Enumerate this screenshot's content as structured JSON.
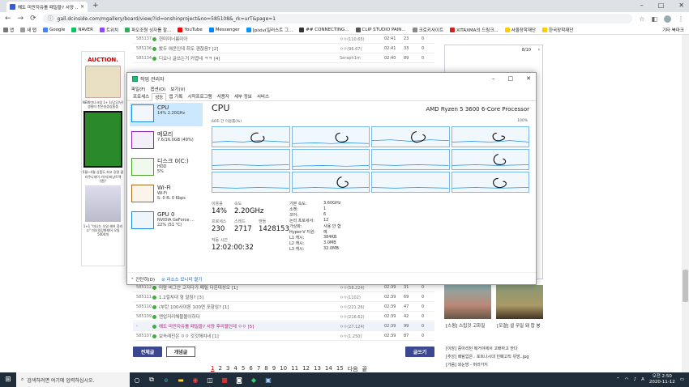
{
  "browser": {
    "tab_title": "해도 미만자유를 패밀을? 서양 ...",
    "url": "gall.dcinside.com/mgallery/board/view/?id=onshinproject&no=585108&_rk=urT&page=1",
    "bookmarks": [
      "앱",
      "새 탭",
      "Google",
      "NAVER",
      "트위치",
      "파오조원 싱자를 할...",
      "YouTube",
      "Messenger",
      "[pixiv(일러스트 그...",
      "## CONNECTING...",
      "CLIP STUDIO PAIN...",
      "크로키사이트",
      "XITAXMA의 드링크...",
      "서울장학재단",
      "한국장학재단"
    ],
    "bookmarks_right": "기타 북마크"
  },
  "board_top": [
    {
      "no": "585137",
      "subject": "현미미너름미아",
      "writer": "ㅇㅇ(110.65)",
      "date": "02:41",
      "views": "23",
      "rec": "0"
    },
    {
      "no": "585136",
      "subject": "봤두 애쿤인데 최도 괜찮음? [2]",
      "writer": "ㅇㅇ(96.67)",
      "date": "02:41",
      "views": "33",
      "rec": "0"
    },
    {
      "no": "585134",
      "subject": "디오나 글쓰는거 커엽네 ㅋㅋ [4]",
      "writer": "Seraph1m",
      "date": "02:40",
      "views": "89",
      "rec": "0"
    }
  ],
  "board_bottom": [
    {
      "no": "585112",
      "subject": "미맘 버그안 고저다가 폐릴 다운대성오 [1]",
      "writer": "ㅇㅇ(58.224)",
      "date": "02:39",
      "views": "31",
      "rec": "0",
      "hl": false
    },
    {
      "no": "585111",
      "subject": "1.2컬치대 형 말짐? [3]",
      "writer": "ㅇㅇ(1102)",
      "date": "02:39",
      "views": "69",
      "rec": "0",
      "hl": false
    },
    {
      "no": "585110",
      "subject": "(부탄 100사이론 100연 포함임? [1]",
      "writer": "ㅇㅇ(221.26)",
      "date": "02:39",
      "views": "47",
      "rec": "0",
      "hl": false
    },
    {
      "no": "585109",
      "subject": "엔업저리해물몰아하다",
      "writer": "ㅇㅇ(216.62)",
      "date": "02:39",
      "views": "42",
      "rec": "0",
      "hl": false
    },
    {
      "no": "›",
      "subject": "해도 미만자유를 패밀을? 서양 후리웹인데 ㅇㅇ [5]",
      "writer": "ㅇㅇ(27.124)",
      "date": "02:39",
      "views": "99",
      "rec": "0",
      "hl": true
    },
    {
      "no": "585107",
      "subject": "보속래진은 ㅇㅇ 갓갓해치네 [1]",
      "writer": "ㅇㅇ(1.250)",
      "date": "02:39",
      "views": "87",
      "rec": "0",
      "hl": false
    }
  ],
  "board_buttons": {
    "all": "전체글",
    "featured": "개념글",
    "write": "글쓰기"
  },
  "pager": [
    "1",
    "2",
    "3",
    "4",
    "5",
    "6",
    "7",
    "8",
    "9",
    "10",
    "11",
    "12",
    "13",
    "14",
    "15",
    "다음",
    "끝"
  ],
  "ad": {
    "brand": "AUCTION.",
    "t1": "NEW미나크림 1+ 1/당무/난/생필터 찬은실생상흡품",
    "t2": "5월~4월 싱품도 최고 강령 괄리쿠니데이 가(지)비냥트렉(엔)!",
    "t3": "1+1 \"미나는 오일 헤어 정리소\" 미오일강화테어 오일 5400개"
  },
  "right": {
    "counter": "8/10",
    "cap1": "[스윔] 스팁것 고화질",
    "cap2": "[모결] 셜 무밀 돼 합 봉",
    "news1": "[이장] 중아리턴 메거야에서 고배하고 한다",
    "news2": "[추앙] 배탐업은.. 포트나시대 민폐고직 유방..jpg",
    "news3": "[가음] 외눈방 - 머러가지"
  },
  "tm": {
    "title": "작업 관리자",
    "menu": [
      "파일(F)",
      "옵션(O)",
      "보기(V)"
    ],
    "tabs": [
      "프로세스",
      "성능",
      "앱 기록",
      "시작프로그램",
      "사용자",
      "세부 정보",
      "서비스"
    ],
    "side": [
      {
        "name": "CPU",
        "sub1": "14%  2.20GHz",
        "sub2": "",
        "cls": ""
      },
      {
        "name": "메모리",
        "sub1": "7.6/16.0GB (49%)",
        "sub2": "",
        "cls": "mem"
      },
      {
        "name": "디스크 0(C:)",
        "sub1": "HDD",
        "sub2": "5%",
        "cls": "disk"
      },
      {
        "name": "Wi-Fi",
        "sub1": "Wi-Fi",
        "sub2": "S: 0  R: 0 Kbps",
        "cls": "wifi"
      },
      {
        "name": "GPU 0",
        "sub1": "NVIDIA GeForce ...",
        "sub2": "22% (51 °C)",
        "cls": "gpu"
      }
    ],
    "cpu_title": "CPU",
    "model": "AMD Ryzen 5 3600 6-Core Processor",
    "graph_label": "60초 간 이용률(%)",
    "graph_max": "100%",
    "util_label": "이용률",
    "util": "14%",
    "speed_label": "속도",
    "speed": "2.20GHz",
    "proc_label": "프로세스",
    "proc": "230",
    "thread_label": "스레드",
    "thread": "2717",
    "handle_label": "핸들",
    "handle": "1428153",
    "uptime_label": "작동 시간",
    "uptime": "12:02:00:32",
    "specs": [
      [
        "기본 속도:",
        "3.60GHz"
      ],
      [
        "소켓:",
        "1"
      ],
      [
        "코어:",
        "6"
      ],
      [
        "논리 프로세서:",
        "12"
      ],
      [
        "가상화:",
        "사용 안 함"
      ],
      [
        "Hyper-V 지원:",
        "예"
      ],
      [
        "L1 캐시:",
        "384KB"
      ],
      [
        "L2 캐시:",
        "3.0MB"
      ],
      [
        "L3 캐시:",
        "32.0MB"
      ]
    ],
    "fewer": "간단히(D)",
    "monitor": "리소스 모니터 열기"
  },
  "taskbar": {
    "search": "검색하려면 여기에 입력하십시오.",
    "time": "오전 2:50",
    "date": "2020-11-12"
  },
  "colors": {
    "cpu_blue": "#1c8de0",
    "board_blue": "#3b4890",
    "taskbar": "#1f2d3a"
  }
}
